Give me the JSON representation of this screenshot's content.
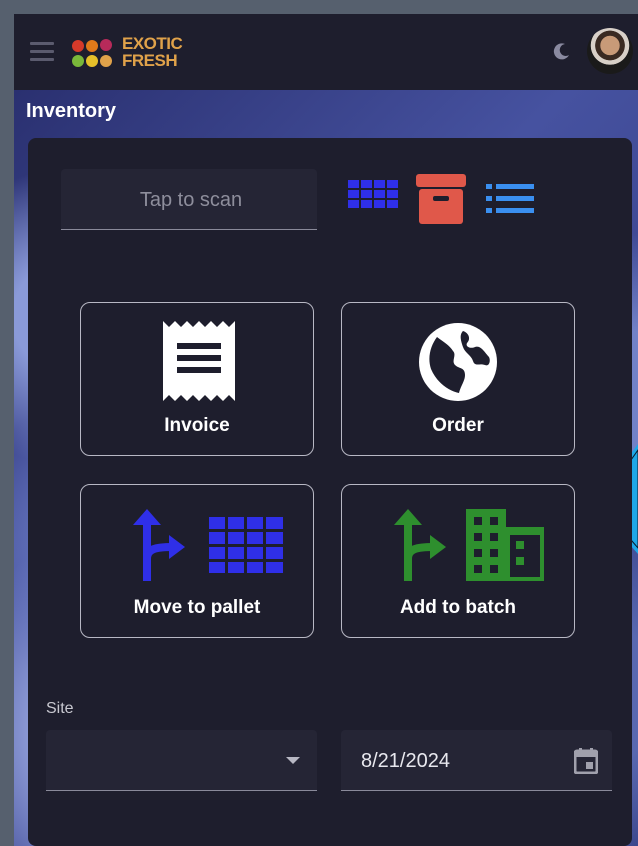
{
  "app": {
    "logo_line1": "EXOTIC",
    "logo_line2": "FRESH",
    "page_title": "Inventory"
  },
  "scan": {
    "placeholder": "Tap to scan"
  },
  "view_icons": [
    "grid-view-icon",
    "archive-box-icon",
    "list-view-icon"
  ],
  "tiles": [
    {
      "label": "Invoice",
      "icon": "receipt-icon"
    },
    {
      "label": "Order",
      "icon": "globe-icon"
    },
    {
      "label": "Move to pallet",
      "icon": "split-arrow-grid-icon"
    },
    {
      "label": "Add to batch",
      "icon": "split-arrow-building-icon"
    }
  ],
  "form": {
    "site_label": "Site",
    "site_value": "",
    "date_value": "8/21/2024"
  },
  "colors": {
    "accent_blue": "#2f2fe8",
    "list_blue": "#3a8ff0",
    "archive_red": "#e0584a",
    "green": "#2e8f2e",
    "panel_bg": "#1e1e2d"
  }
}
